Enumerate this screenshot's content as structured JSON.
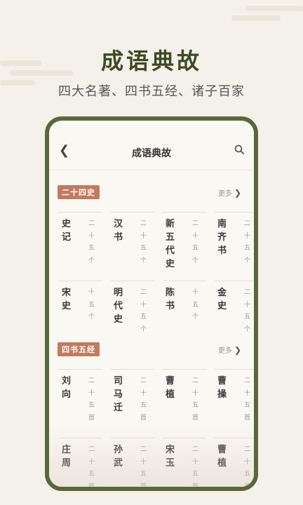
{
  "hero": {
    "title": "成语典故",
    "subtitle": "四大名著、四书五经、诸子百家"
  },
  "app": {
    "nav_title": "成语典故",
    "back_icon": "chevron-left-icon",
    "search_icon": "search-icon"
  },
  "sections": [
    {
      "badge": "二十四史",
      "more": "更多",
      "items": [
        {
          "name": "史记",
          "count": "二十五个"
        },
        {
          "name": "汉书",
          "count": "二十五个"
        },
        {
          "name": "新五代史",
          "count": "二十五个"
        },
        {
          "name": "南齐书",
          "count": "二十五个"
        },
        {
          "name": "宋史",
          "count": "十五个"
        },
        {
          "name": "明代史",
          "count": "二十五个"
        },
        {
          "name": "陈书",
          "count": "十五个"
        },
        {
          "name": "金史",
          "count": "二十五个"
        }
      ]
    },
    {
      "badge": "四书五经",
      "more": "更多",
      "items": [
        {
          "name": "刘向",
          "count": "二十五首"
        },
        {
          "name": "司马迁",
          "count": "二十五首"
        },
        {
          "name": "曹植",
          "count": "二十五首"
        },
        {
          "name": "曹操",
          "count": "二十五首"
        },
        {
          "name": "庄周",
          "count": "二十五首"
        },
        {
          "name": "孙武",
          "count": "二十五首"
        },
        {
          "name": "宋玉",
          "count": "二十五首"
        },
        {
          "name": "曹植",
          "count": "二十五首"
        }
      ]
    }
  ],
  "colors": {
    "accent_green": "#59683a",
    "badge_red": "#c47a5e",
    "background": "#f4f1ea"
  }
}
